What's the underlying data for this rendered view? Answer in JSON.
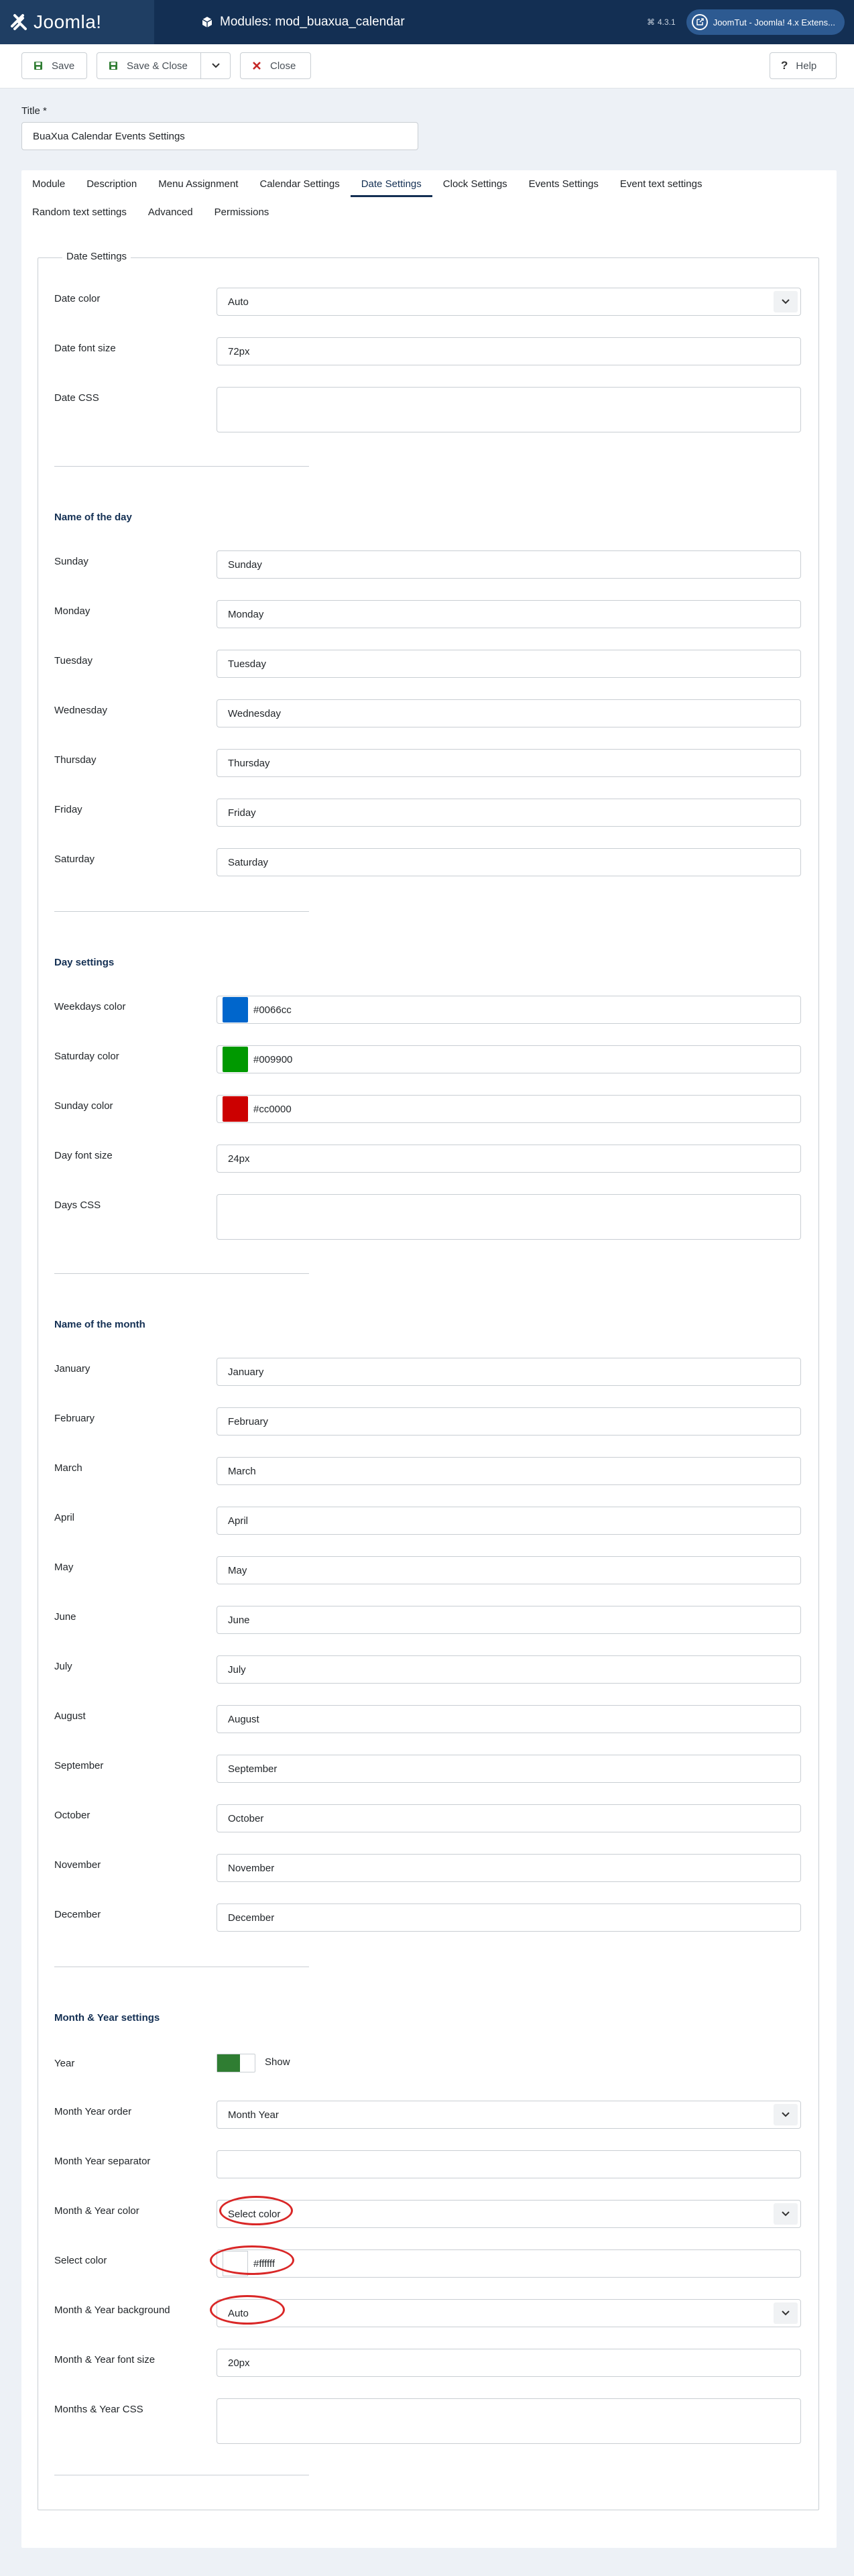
{
  "header": {
    "logo_text": "Joomla!",
    "page_title": "Modules: mod_buaxua_calendar",
    "version": "4.3.1",
    "site_link": "JoomTut - Joomla! 4.x Extens..."
  },
  "toolbar": {
    "save": "Save",
    "save_close": "Save & Close",
    "close": "Close",
    "help": "Help"
  },
  "title_field": {
    "label": "Title *",
    "value": "BuaXua Calendar Events Settings"
  },
  "tabs": [
    {
      "label": "Module"
    },
    {
      "label": "Description"
    },
    {
      "label": "Menu Assignment"
    },
    {
      "label": "Calendar Settings"
    },
    {
      "label": "Date Settings",
      "active": true
    },
    {
      "label": "Clock Settings"
    },
    {
      "label": "Events Settings"
    },
    {
      "label": "Event text settings"
    },
    {
      "label": "Random text settings"
    },
    {
      "label": "Advanced"
    },
    {
      "label": "Permissions"
    }
  ],
  "fieldset_legend": "Date Settings",
  "date": {
    "color_label": "Date color",
    "color_value": "Auto",
    "font_label": "Date font size",
    "font_value": "72px",
    "css_label": "Date CSS",
    "css_value": ""
  },
  "day_names": {
    "heading": "Name of the day",
    "items": [
      {
        "label": "Sunday",
        "value": "Sunday"
      },
      {
        "label": "Monday",
        "value": "Monday"
      },
      {
        "label": "Tuesday",
        "value": "Tuesday"
      },
      {
        "label": "Wednesday",
        "value": "Wednesday"
      },
      {
        "label": "Thursday",
        "value": "Thursday"
      },
      {
        "label": "Friday",
        "value": "Friday"
      },
      {
        "label": "Saturday",
        "value": "Saturday"
      }
    ]
  },
  "day_settings": {
    "heading": "Day settings",
    "weekdays_label": "Weekdays color",
    "weekdays_value": "#0066cc",
    "weekdays_swatch": "#0066cc",
    "saturday_label": "Saturday color",
    "saturday_value": "#009900",
    "saturday_swatch": "#009900",
    "sunday_label": "Sunday color",
    "sunday_value": "#cc0000",
    "sunday_swatch": "#cc0000",
    "font_label": "Day font size",
    "font_value": "24px",
    "css_label": "Days CSS",
    "css_value": ""
  },
  "month_names": {
    "heading": "Name of the month",
    "items": [
      {
        "label": "January",
        "value": "January"
      },
      {
        "label": "February",
        "value": "February"
      },
      {
        "label": "March",
        "value": "March"
      },
      {
        "label": "April",
        "value": "April"
      },
      {
        "label": "May",
        "value": "May"
      },
      {
        "label": "June",
        "value": "June"
      },
      {
        "label": "July",
        "value": "July"
      },
      {
        "label": "August",
        "value": "August"
      },
      {
        "label": "September",
        "value": "September"
      },
      {
        "label": "October",
        "value": "October"
      },
      {
        "label": "November",
        "value": "November"
      },
      {
        "label": "December",
        "value": "December"
      }
    ]
  },
  "month_year": {
    "heading": "Month & Year settings",
    "year_label": "Year",
    "year_toggle": "Show",
    "order_label": "Month Year order",
    "order_value": "Month Year",
    "separator_label": "Month Year separator",
    "separator_value": "",
    "color_label": "Month & Year color",
    "color_value": "Select color",
    "select_color_label": "Select color",
    "select_color_value": "#ffffff",
    "bg_label": "Month & Year background",
    "bg_value": "Auto",
    "font_label": "Month & Year font size",
    "font_value": "20px",
    "css_label": "Months & Year CSS",
    "css_value": ""
  },
  "colors": {
    "header_bg": "#132f53",
    "toggle_on": "#2f7d32",
    "highlight": "#d92727"
  }
}
